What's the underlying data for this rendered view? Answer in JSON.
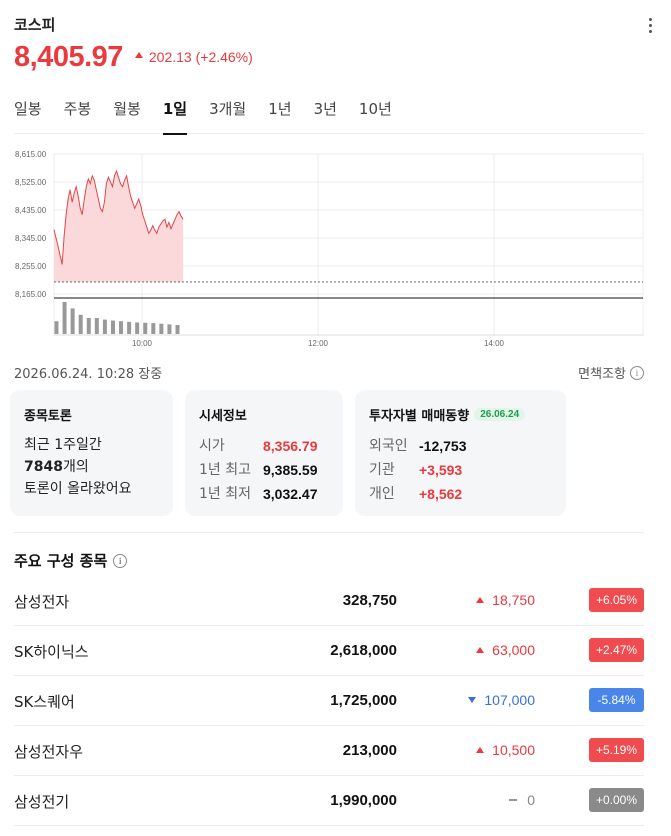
{
  "header": {
    "title": "코스피",
    "price": "8,405.97",
    "change": "202.13 (+2.46%)"
  },
  "tabs": [
    {
      "label": "일봉",
      "active": false
    },
    {
      "label": "주봉",
      "active": false
    },
    {
      "label": "월봉",
      "active": false
    },
    {
      "label": "1일",
      "active": true
    },
    {
      "label": "3개월",
      "active": false
    },
    {
      "label": "1년",
      "active": false
    },
    {
      "label": "3년",
      "active": false
    },
    {
      "label": "10년",
      "active": false
    }
  ],
  "chart_data": {
    "type": "area",
    "y_ticks": [
      "8,615.00",
      "8,525.00",
      "8,435.00",
      "8,345.00",
      "8,255.00",
      "8,165.00"
    ],
    "ylim": [
      8165,
      8615
    ],
    "x_ticks": [
      "10:00",
      "12:00",
      "14:00"
    ],
    "previous_close": 8203.84,
    "series": [
      {
        "values": [
          8372,
          8345,
          8320,
          8290,
          8260,
          8350,
          8420,
          8470,
          8500,
          8460,
          8490,
          8510,
          8480,
          8440,
          8420,
          8470,
          8510,
          8535,
          8520,
          8545,
          8530,
          8500,
          8470,
          8440,
          8430,
          8460,
          8520,
          8540,
          8525,
          8510,
          8545,
          8560,
          8540,
          8520,
          8510,
          8530,
          8545,
          8510,
          8480,
          8460,
          8440,
          8455,
          8470,
          8450,
          8420,
          8400,
          8380,
          8360,
          8370,
          8385,
          8370,
          8360,
          8380,
          8390,
          8400,
          8405,
          8380,
          8395,
          8375,
          8390,
          8405,
          8420,
          8430,
          8415,
          8405
        ]
      }
    ],
    "volume": [
      4,
      10,
      8,
      6,
      5,
      5,
      4.5,
      4.2,
      4,
      3.8,
      3.6,
      3.5,
      3.4,
      3.2,
      3.0,
      2.8
    ]
  },
  "timestamp": "2026.06.24. 10:28 장중",
  "disclaimer": "면책조항",
  "cards": {
    "discussion": {
      "title": "종목토론",
      "line1": "최근 1주일간",
      "count": "7848",
      "line2_suffix": "개의",
      "line3": "토론이 올라왔어요"
    },
    "quote": {
      "title": "시세정보",
      "rows": [
        {
          "label": "시가",
          "value": "8,356.79"
        },
        {
          "label": "1년 최고",
          "value": "9,385.59"
        },
        {
          "label": "1년 최저",
          "value": "3,032.47"
        }
      ]
    },
    "investors": {
      "title": "투자자별 매매동향",
      "date": "26.06.24",
      "rows": [
        {
          "label": "외국인",
          "value": "-12,753"
        },
        {
          "label": "기관",
          "value": "+3,593"
        },
        {
          "label": "개인",
          "value": "+8,562"
        }
      ]
    }
  },
  "section_title": "주요 구성 종목",
  "stocks": [
    {
      "name": "삼성전자",
      "price": "328,750",
      "change": "18,750",
      "rate": "+6.05%",
      "dir": "up"
    },
    {
      "name": "SK하이닉스",
      "price": "2,618,000",
      "change": "63,000",
      "rate": "+2.47%",
      "dir": "up"
    },
    {
      "name": "SK스퀘어",
      "price": "1,725,000",
      "change": "107,000",
      "rate": "-5.84%",
      "dir": "down"
    },
    {
      "name": "삼성전자우",
      "price": "213,000",
      "change": "10,500",
      "rate": "+5.19%",
      "dir": "up"
    },
    {
      "name": "삼성전기",
      "price": "1,990,000",
      "change": "0",
      "rate": "+0.00%",
      "dir": "flat"
    }
  ],
  "colors": {
    "up": "#ea3a3d",
    "down": "#3b6fd8",
    "flat": "#888888",
    "up_badge": "#f04b4f",
    "down_badge": "#4a86e8",
    "flat_badge": "#8a8a8a",
    "area_fill": "#fbd9da",
    "line": "#e0464a"
  }
}
